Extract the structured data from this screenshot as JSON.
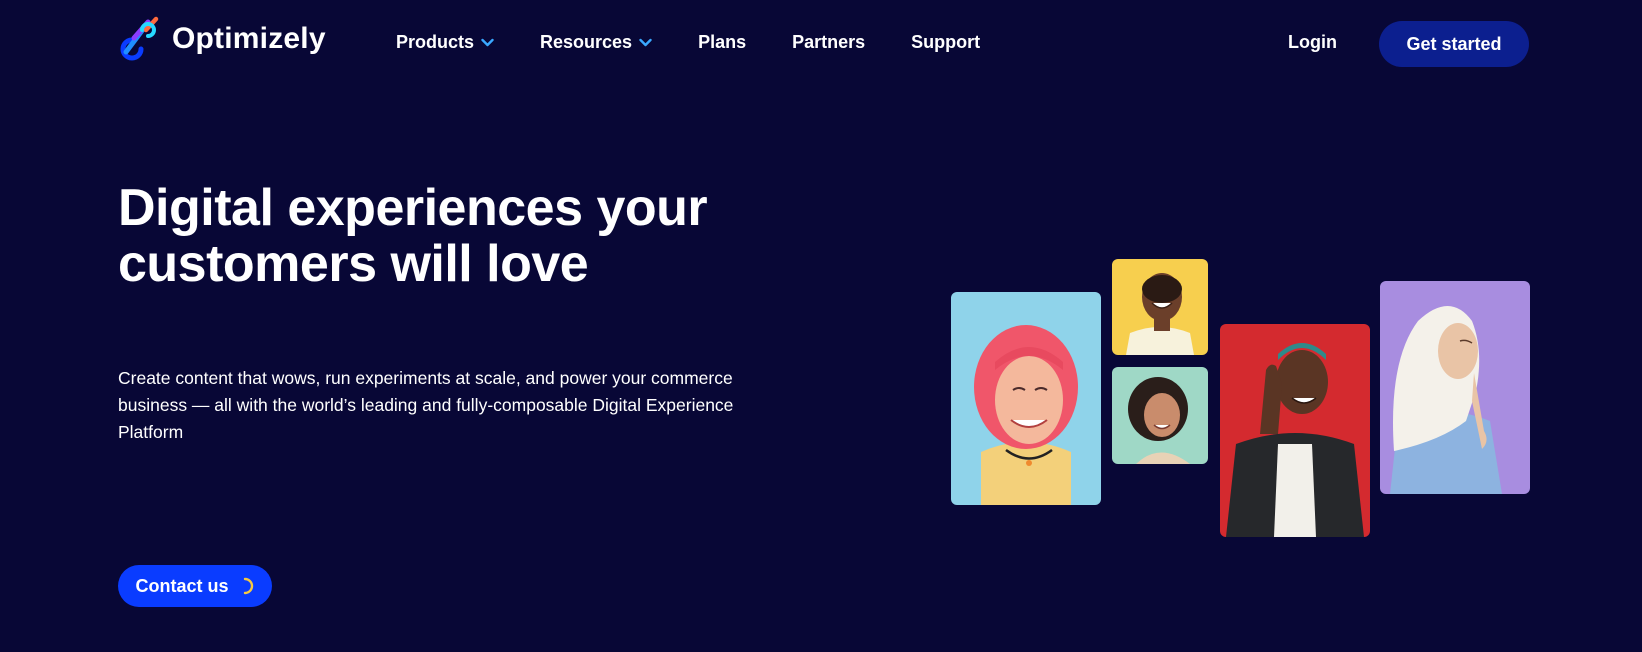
{
  "brand": {
    "name": "Optimizely"
  },
  "nav": {
    "items": [
      {
        "label": "Products",
        "has_dropdown": true
      },
      {
        "label": "Resources",
        "has_dropdown": true
      },
      {
        "label": "Plans",
        "has_dropdown": false
      },
      {
        "label": "Partners",
        "has_dropdown": false
      },
      {
        "label": "Support",
        "has_dropdown": false
      }
    ],
    "login_label": "Login",
    "cta_label": "Get started"
  },
  "hero": {
    "title_line1": "Digital experiences your",
    "title_line2": "customers will love",
    "description": "Create content that wows, run experiments at scale, and power your commerce business — all with the world’s leading and fully-composable Digital Experience Platform",
    "contact_label": "Contact us"
  },
  "icons": {
    "dropdown": "chevron-down-icon",
    "loading": "loading-spinner-icon"
  },
  "colors": {
    "background": "#080736",
    "primary_button": "#0c1f8f",
    "contact_button": "#0a3cff",
    "chevron": "#3aa8ff",
    "spinner": "#f5c842"
  }
}
